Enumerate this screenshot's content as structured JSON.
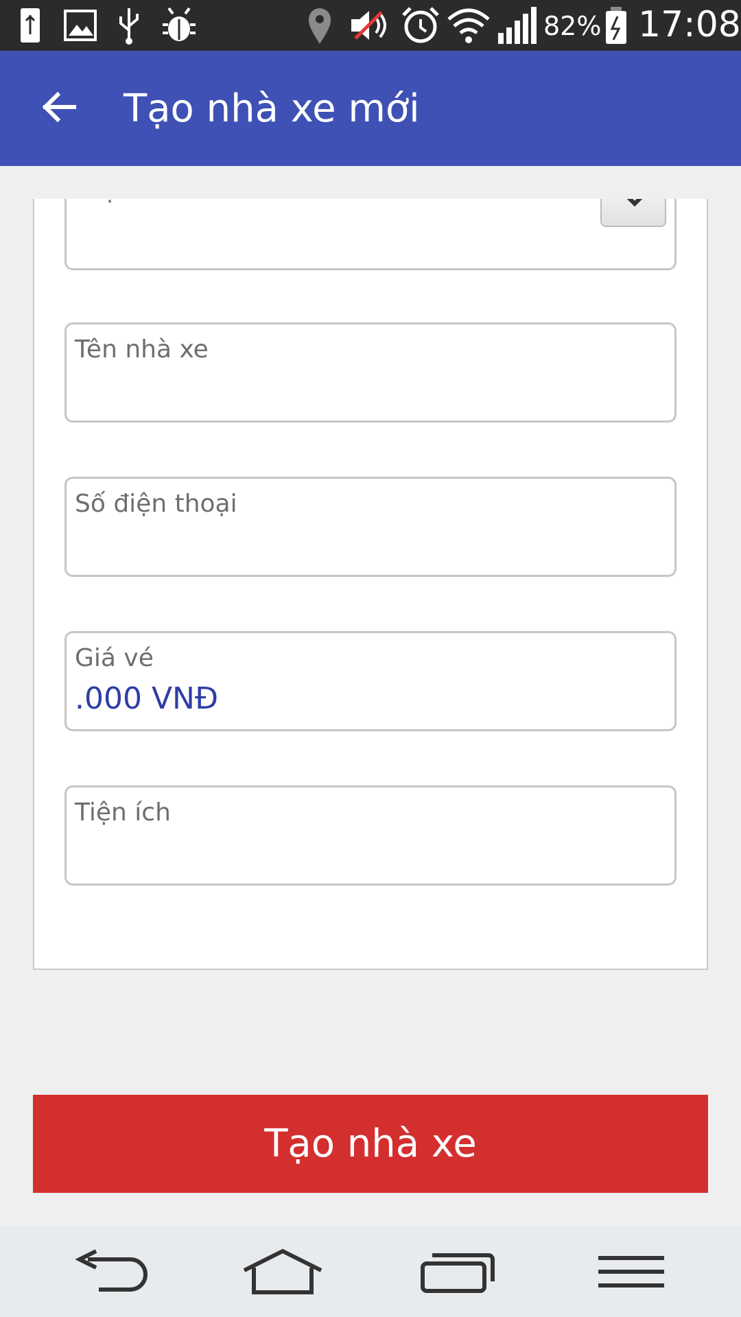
{
  "status_bar": {
    "battery_percent": "82%",
    "time": "17:08",
    "icons": [
      "battery-charging-icon",
      "image-icon",
      "usb-icon",
      "debug-bug-icon",
      "location-icon",
      "mute-icon",
      "alarm-icon",
      "wifi-icon",
      "signal-icon",
      "battery-icon"
    ]
  },
  "app_bar": {
    "title": "Tạo nhà xe mới",
    "back_icon": "arrow-left-icon"
  },
  "form": {
    "vehicle_type": {
      "label": "Loại xe",
      "value": ""
    },
    "company_name": {
      "label": "Tên nhà xe",
      "value": ""
    },
    "phone": {
      "label": "Số điện thoại",
      "value": ""
    },
    "price": {
      "label": "Giá vé",
      "value": ".000 VNĐ"
    },
    "amenities": {
      "label": "Tiện ích",
      "value": ""
    }
  },
  "submit": {
    "label": "Tạo nhà xe"
  },
  "nav_bar": {
    "icons": [
      "nav-back-icon",
      "nav-home-icon",
      "nav-recents-icon",
      "nav-menu-icon"
    ]
  },
  "colors": {
    "app_bar": "#3f51b5",
    "submit": "#d32f2f",
    "value_text": "#2f3da5",
    "status_bar": "#2b2b2b"
  }
}
